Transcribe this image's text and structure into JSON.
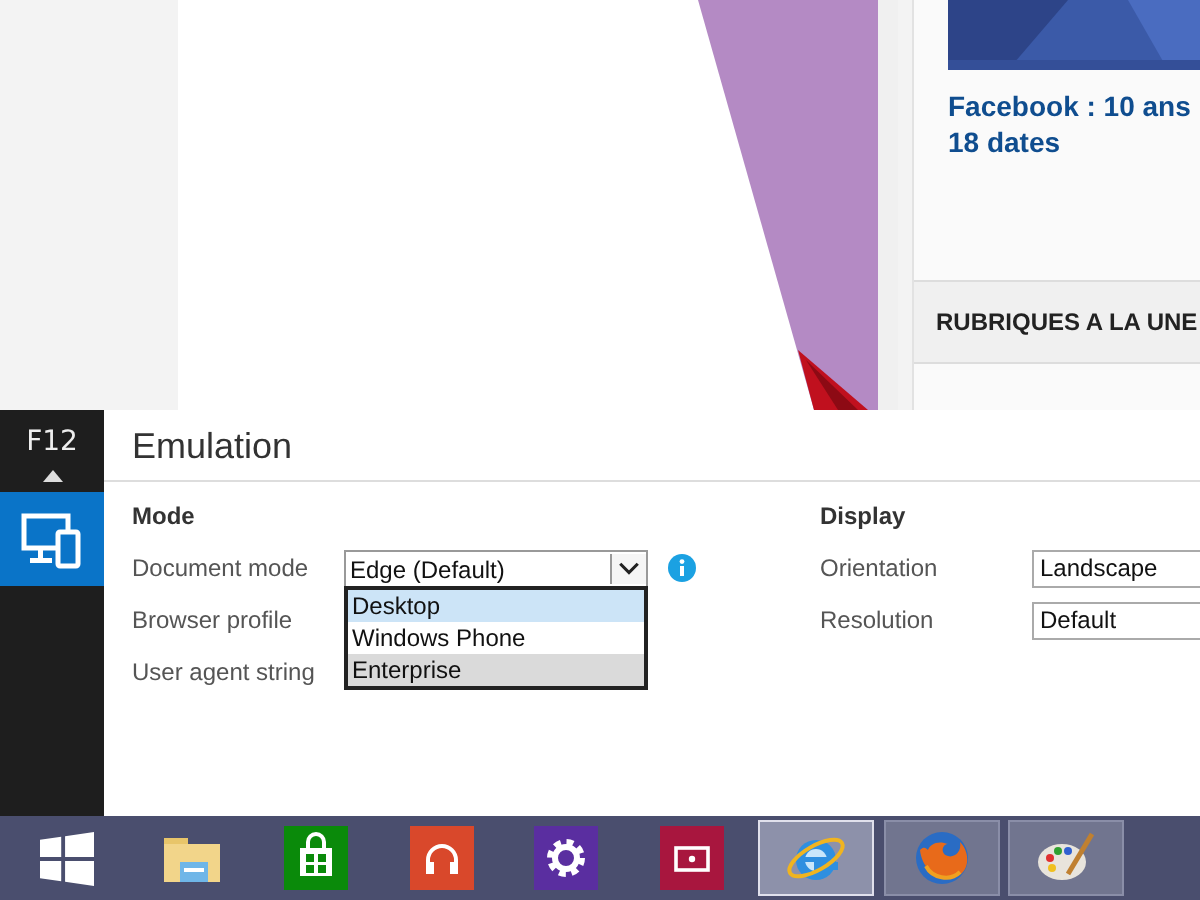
{
  "web_page": {
    "headline": "Facebook : 10 ans\n18 dates",
    "section_header": "RUBRIQUES A LA UNE"
  },
  "devtools": {
    "shortcut": "F12",
    "tools": [
      {
        "kind": "emulation",
        "selected": true
      }
    ],
    "title": "Emulation",
    "mode": {
      "heading": "Mode",
      "rows": [
        {
          "label": "Document mode",
          "kind": "select",
          "value": "Edge (Default)",
          "info": true
        },
        {
          "label": "Browser profile",
          "kind": "dropdown",
          "options": [
            {
              "label": "Desktop",
              "selected": true,
              "hovered": false
            },
            {
              "label": "Windows Phone",
              "selected": false,
              "hovered": false
            },
            {
              "label": "Enterprise",
              "selected": false,
              "hovered": true
            }
          ]
        },
        {
          "label": "User agent string",
          "kind": "hidden"
        }
      ]
    },
    "display": {
      "heading": "Display",
      "rows": [
        {
          "label": "Orientation",
          "value": "Landscape"
        },
        {
          "label": "Resolution",
          "value": "Default"
        }
      ]
    }
  },
  "taskbar": {
    "items": [
      {
        "kind": "start",
        "running": false
      },
      {
        "kind": "folder",
        "running": false
      },
      {
        "kind": "store",
        "running": false
      },
      {
        "kind": "music",
        "running": false
      },
      {
        "kind": "settings",
        "running": false
      },
      {
        "kind": "video",
        "running": false
      },
      {
        "kind": "ie",
        "running": true,
        "selected": true
      },
      {
        "kind": "firefox",
        "running": true,
        "selected": false
      },
      {
        "kind": "paint",
        "running": true,
        "selected": false
      }
    ]
  }
}
